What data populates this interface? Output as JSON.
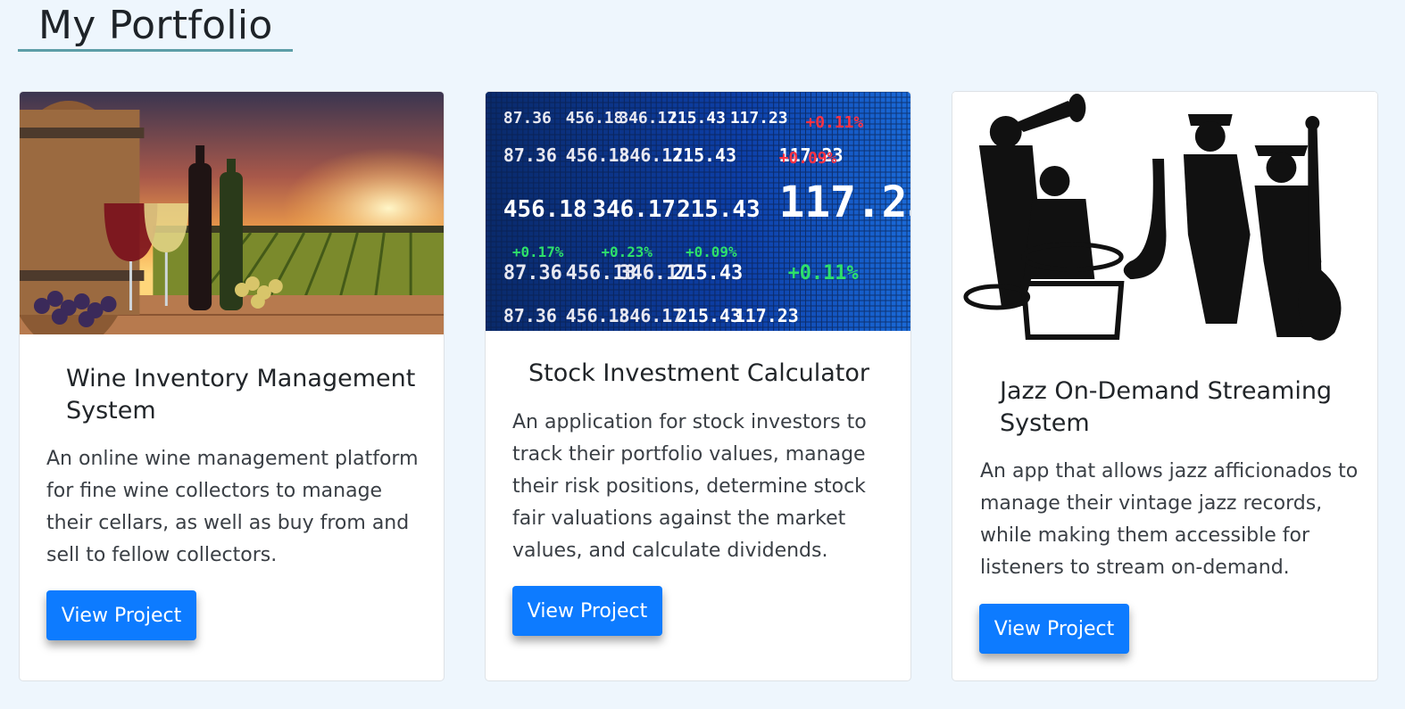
{
  "page": {
    "title": "My Portfolio"
  },
  "projects": [
    {
      "title": "Wine Inventory Management System",
      "description": "An online wine management platform for fine wine collectors to manage their cellars, as well as buy from and sell to fellow collectors.",
      "button_label": "View Project",
      "image_icon": "wine-vineyard-image"
    },
    {
      "title": "Stock Investment Calculator",
      "description": "An application for stock investors to track their portfolio values, manage their risk positions, determine stock fair valuations against the market values, and calculate dividends.",
      "button_label": "View Project",
      "image_icon": "stock-ticker-image",
      "ticker_values": [
        "87.36",
        "456.18",
        "346.17",
        "215.43",
        "117.23",
        "+0.11%",
        "+0.09%",
        "+0.23%",
        "+0.17%"
      ]
    },
    {
      "title": "Jazz On-Demand Streaming System",
      "description": "An app that allows jazz afficionados to manage their vintage jazz records, while making them accessible for listeners to stream on-demand.",
      "button_label": "View Project",
      "image_icon": "jazz-band-image"
    }
  ],
  "colors": {
    "accent": "#0d7bff",
    "background": "#eef6fd",
    "title_underline": "#5d9ea8"
  }
}
